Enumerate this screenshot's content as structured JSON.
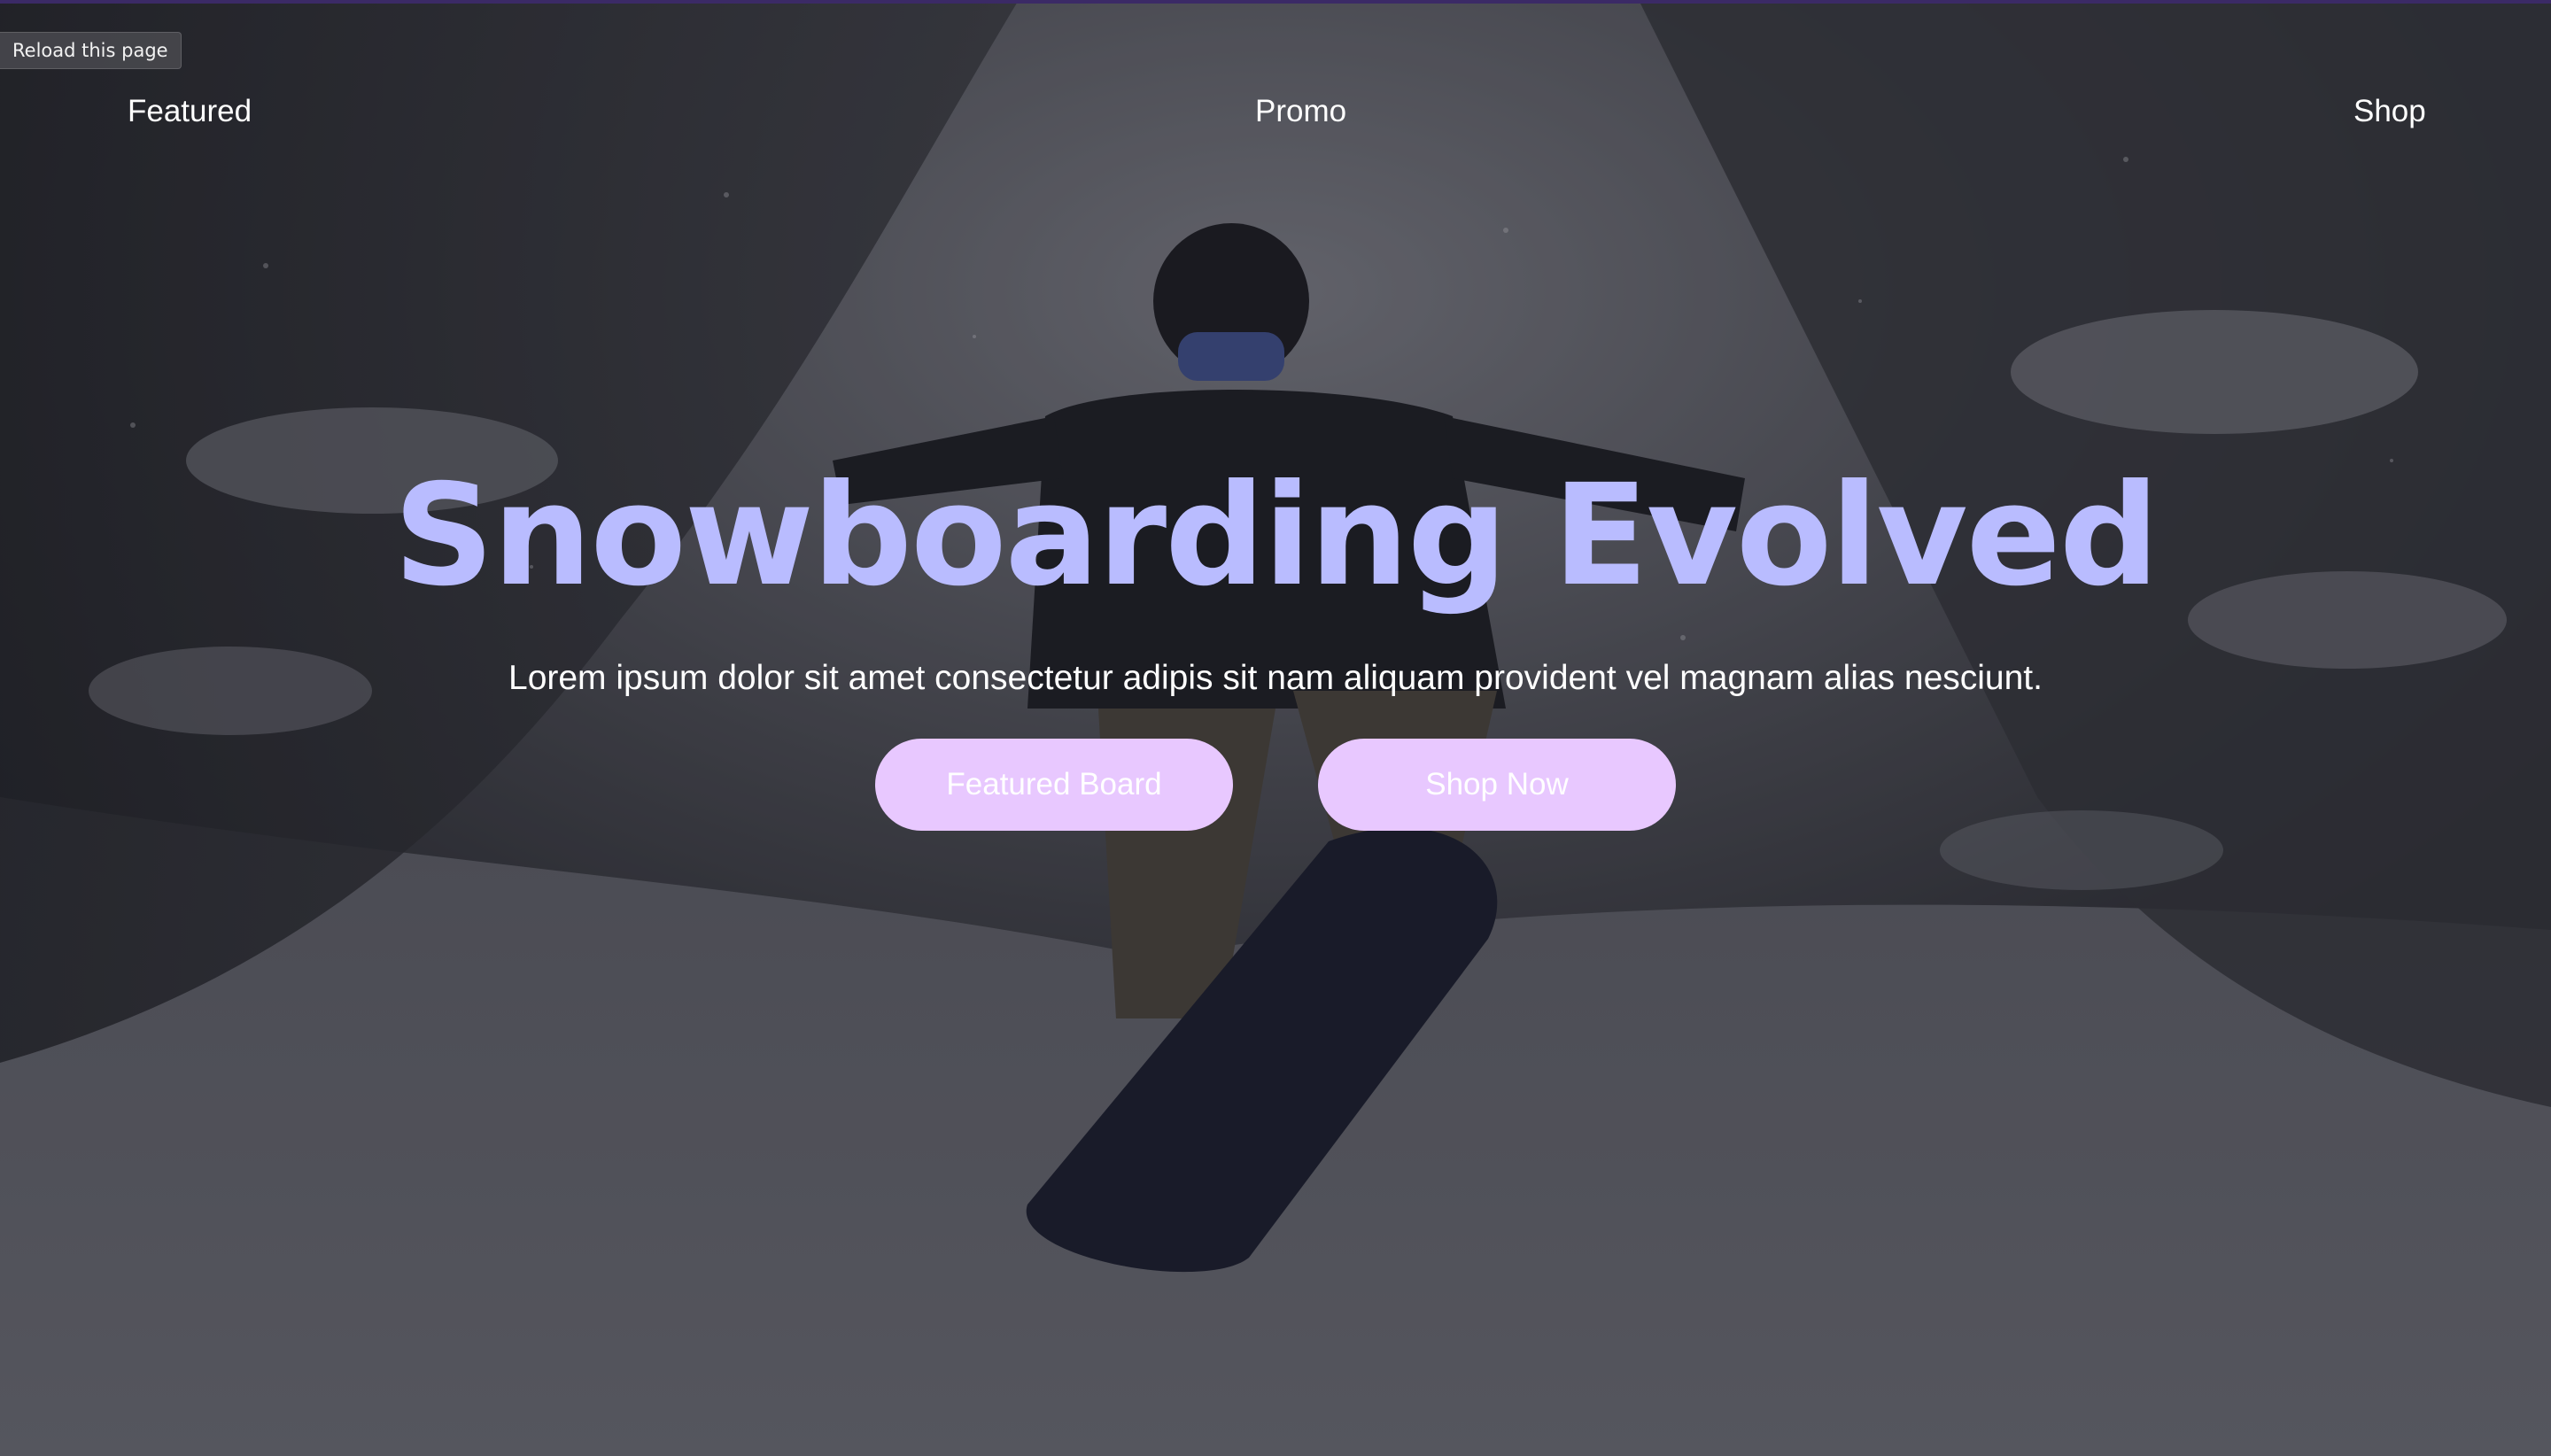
{
  "browser": {
    "reload_tooltip": "Reload this page"
  },
  "nav": {
    "items": [
      {
        "label": "Featured"
      },
      {
        "label": "Promo"
      },
      {
        "label": "Shop"
      }
    ]
  },
  "hero": {
    "title": "Snowboarding Evolved",
    "subtitle": "Lorem ipsum dolor sit amet consectetur adipis sit nam aliquam provident vel magnam alias nesciunt.",
    "buttons": {
      "primary_label": "Featured Board",
      "secondary_label": "Shop Now"
    }
  },
  "colors": {
    "title": "#b9bcff",
    "button_bg": "#e8c8ff",
    "button_text": "#ffffff",
    "nav_text": "#ffffff",
    "overlay": "#2a2b30"
  },
  "background": {
    "image_subject": "snowboarder-jumping-in-snowy-forest"
  }
}
